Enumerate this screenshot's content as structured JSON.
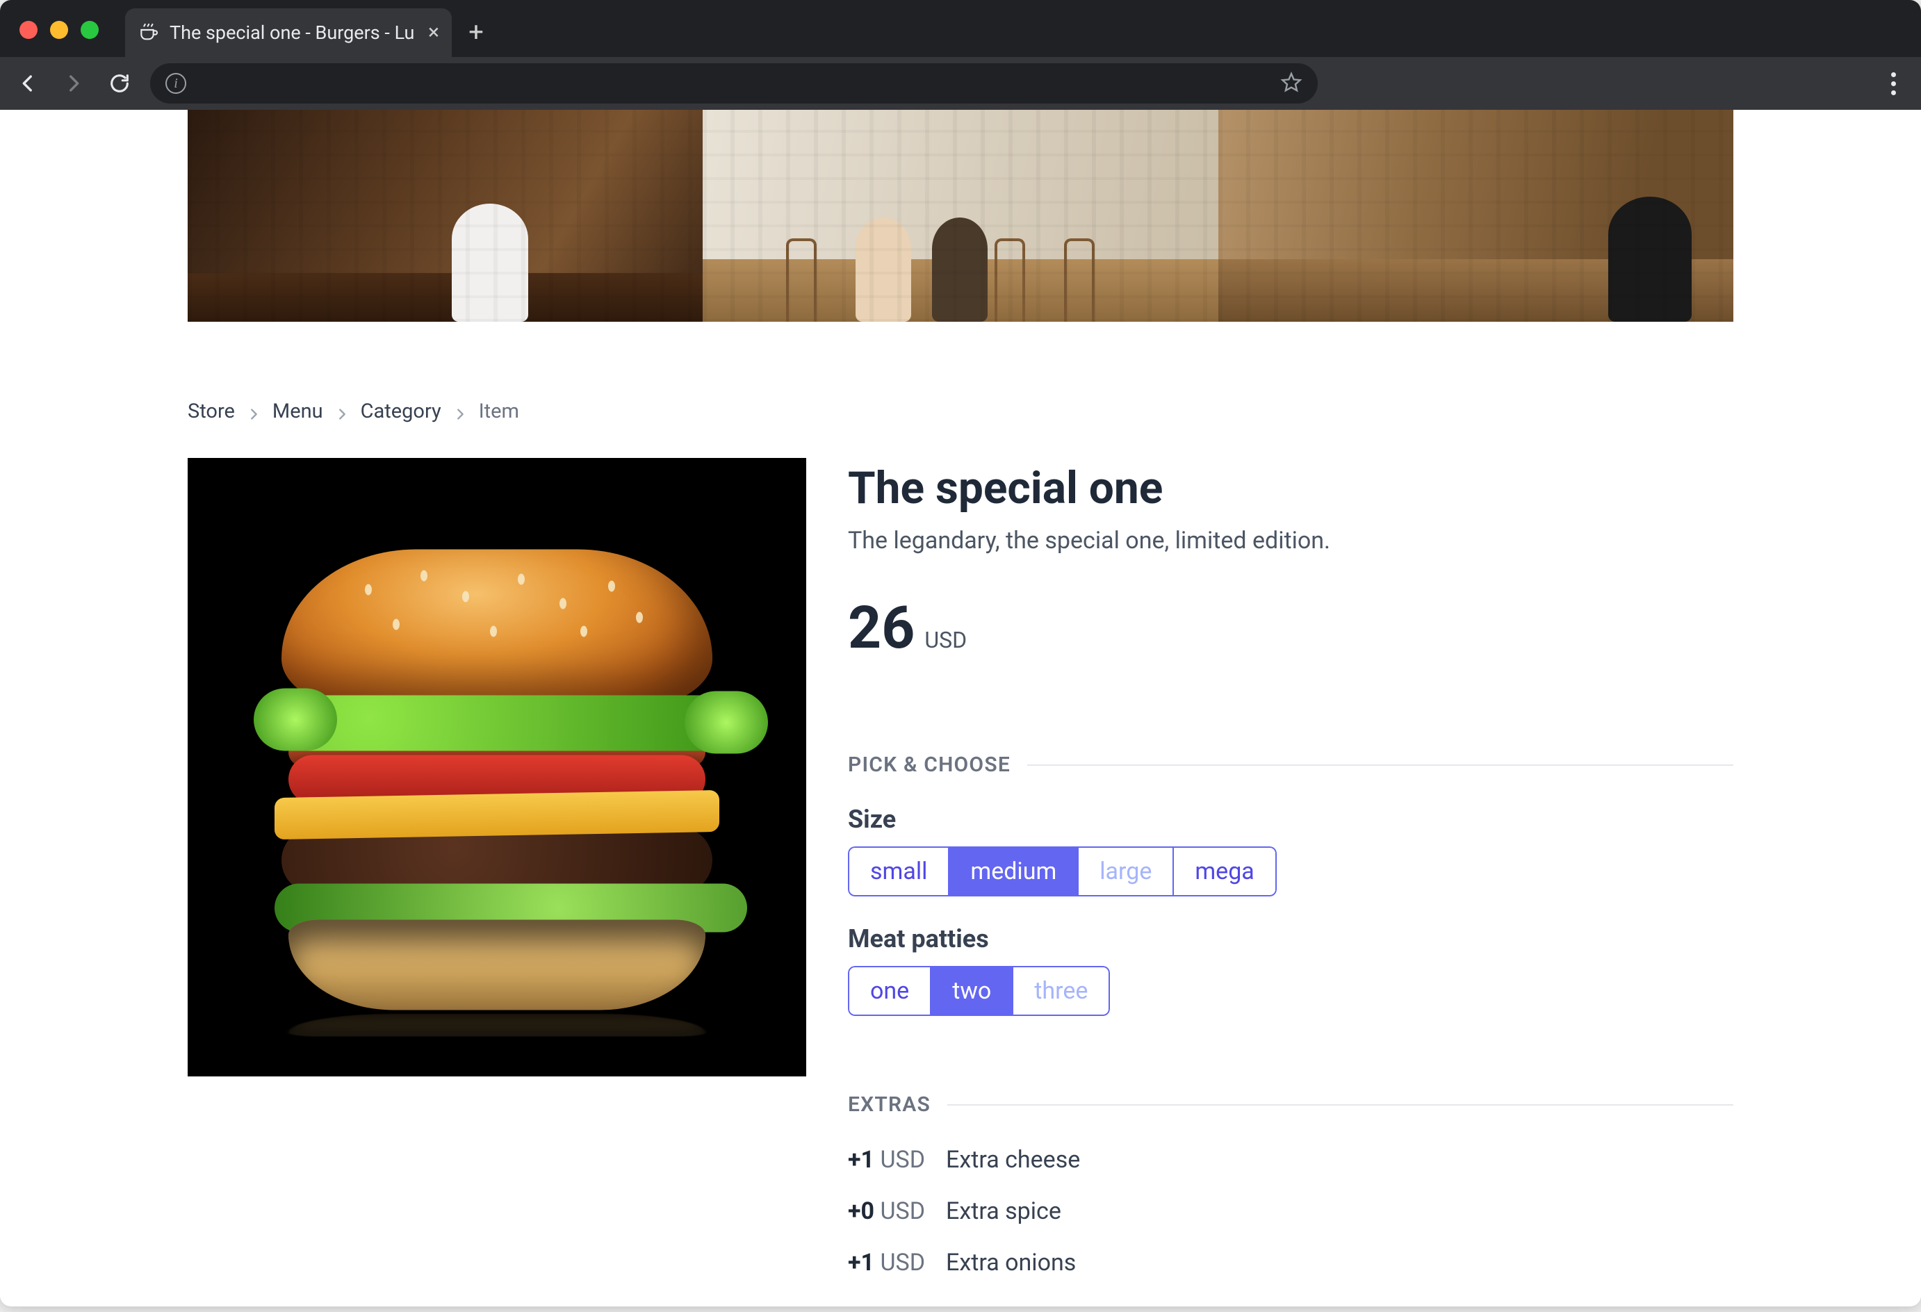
{
  "browser": {
    "tab_title": "The special one - Burgers - Lu",
    "new_tab": "+",
    "close": "×"
  },
  "breadcrumbs": {
    "items": [
      "Store",
      "Menu",
      "Category"
    ],
    "current": "Item"
  },
  "item": {
    "title": "The special one",
    "description": "The legandary, the special one, limited edition.",
    "price": "26",
    "currency": "USD"
  },
  "pick_choose": {
    "heading": "PICK & CHOOSE",
    "size": {
      "label": "Size",
      "options": [
        {
          "label": "small",
          "selected": false,
          "disabled": false
        },
        {
          "label": "medium",
          "selected": true,
          "disabled": false
        },
        {
          "label": "large",
          "selected": false,
          "disabled": true
        },
        {
          "label": "mega",
          "selected": false,
          "disabled": false
        }
      ]
    },
    "patties": {
      "label": "Meat patties",
      "options": [
        {
          "label": "one",
          "selected": false,
          "disabled": false
        },
        {
          "label": "two",
          "selected": true,
          "disabled": false
        },
        {
          "label": "three",
          "selected": false,
          "disabled": true
        }
      ]
    }
  },
  "extras": {
    "heading": "EXTRAS",
    "items": [
      {
        "price": "+1",
        "currency": "USD",
        "name": "Extra cheese"
      },
      {
        "price": "+0",
        "currency": "USD",
        "name": "Extra spice"
      },
      {
        "price": "+1",
        "currency": "USD",
        "name": "Extra onions"
      }
    ]
  }
}
